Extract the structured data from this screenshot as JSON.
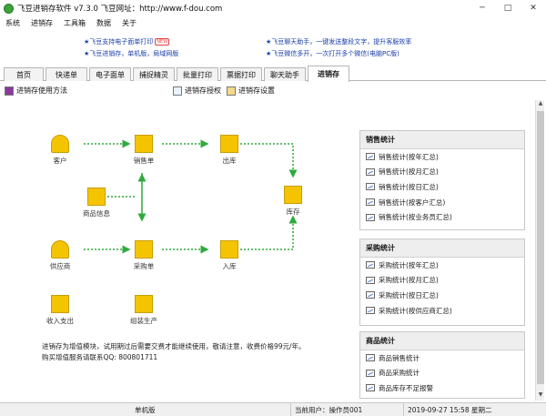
{
  "window": {
    "title": "飞豆进销存软件 v7.3.0 飞豆网址：http://www.f-dou.com",
    "minimize": "─",
    "maximize": "□",
    "close": "✕"
  },
  "menu": [
    "系统",
    "进销存",
    "工具箱",
    "数据",
    "关于"
  ],
  "promo": {
    "left1": "★飞豆支持电子面单打印",
    "left1_badge": "NEW",
    "left2": "★飞豆进销存，单机版，局域网版",
    "right1": "★飞豆聊天助手，一键发送整段文字，提升客服效率",
    "right2": "★飞豆微信多开，一次打开多个微信(电脑PC版)"
  },
  "tabs": [
    "首页",
    "快递单",
    "电子面单",
    "捕捉精灵",
    "批量打印",
    "票据打印",
    "聊天助手",
    "进销存"
  ],
  "toolbar": {
    "guide": "进销存使用方法",
    "license": "进销存授权",
    "settings": "进销存设置"
  },
  "flow": {
    "customer": "客户",
    "sales_order": "销售单",
    "outbound": "出库",
    "product_info": "商品信息",
    "inventory": "库存",
    "supplier": "供应商",
    "purchase_order": "采购单",
    "inbound": "入库",
    "income_expense": "收入支出",
    "assembly": "组装生产"
  },
  "note": {
    "line1": "进销存为增值模块，试用期过后需要交费才能继续使用，敬请注意，收费价格99元/年。",
    "line2": "购买增值服务请联系QQ: 800801711"
  },
  "panels": {
    "sales": {
      "title": "销售统计",
      "items": [
        "销售统计(按年汇总)",
        "销售统计(按月汇总)",
        "销售统计(按日汇总)",
        "销售统计(按客户汇总)",
        "销售统计(按业务员汇总)"
      ]
    },
    "purchase": {
      "title": "采购统计",
      "items": [
        "采购统计(按年汇总)",
        "采购统计(按月汇总)",
        "采购统计(按日汇总)",
        "采购统计(按供应商汇总)"
      ]
    },
    "product": {
      "title": "商品统计",
      "items": [
        "商品销售统计",
        "商品采购统计",
        "商品库存不足报警"
      ]
    }
  },
  "status": {
    "mode": "单机版",
    "user": "当前用户：操作员001",
    "datetime": "2019-09-27  15:58  星期二"
  }
}
